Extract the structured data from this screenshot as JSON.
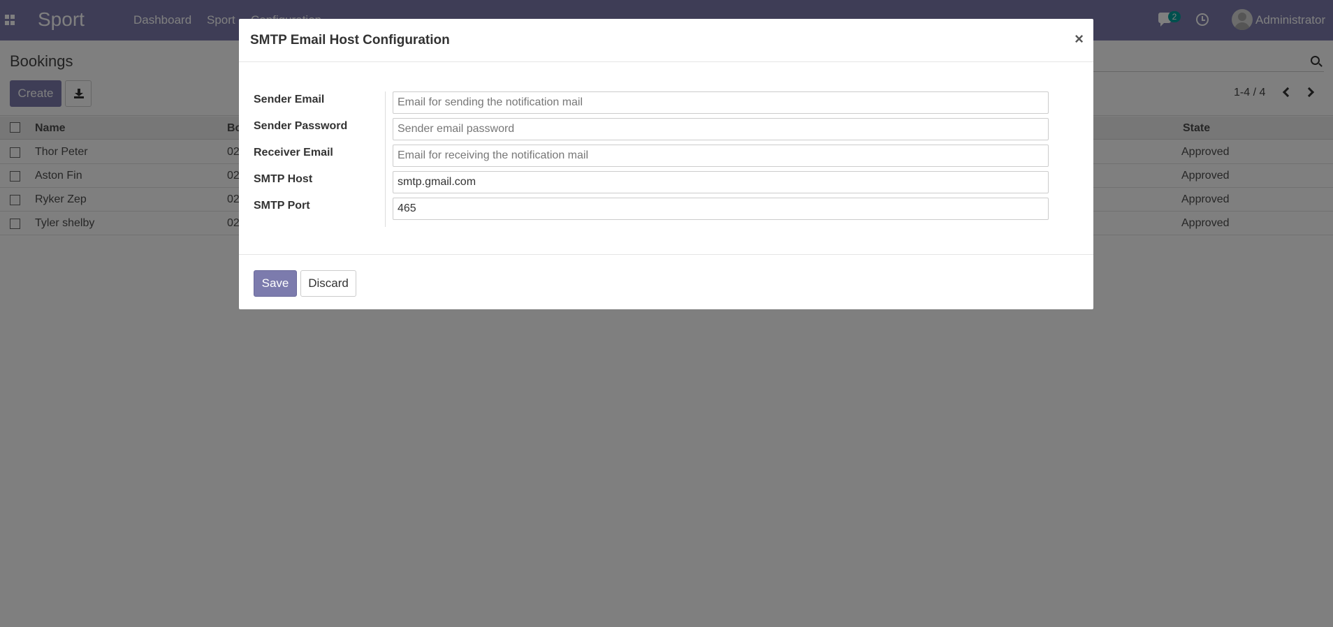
{
  "navbar": {
    "brand": "Sport",
    "menu": [
      "Dashboard",
      "Sport",
      "Configuration"
    ],
    "chat_count": "2",
    "user_name": "Administrator",
    "color": "#7c7bad"
  },
  "control_panel": {
    "breadcrumb": "Bookings",
    "create_label": "Create",
    "pager": "1-4 / 4"
  },
  "list": {
    "columns": [
      "Name",
      "Bo",
      "State"
    ],
    "rows": [
      {
        "name": "Thor Peter",
        "date": "02",
        "state": "Approved"
      },
      {
        "name": "Aston Fin",
        "date": "02",
        "state": "Approved"
      },
      {
        "name": "Ryker Zep",
        "date": "02",
        "state": "Approved"
      },
      {
        "name": "Tyler shelby",
        "date": "02",
        "state": "Approved"
      }
    ]
  },
  "modal": {
    "title": "SMTP Email Host Configuration",
    "close_glyph": "×",
    "fields": [
      {
        "label": "Sender Email",
        "value": "",
        "placeholder": "Email for sending the notification mail"
      },
      {
        "label": "Sender Password",
        "value": "",
        "placeholder": "Sender email password"
      },
      {
        "label": "Receiver Email",
        "value": "",
        "placeholder": "Email for receiving the notification mail"
      },
      {
        "label": "SMTP Host",
        "value": "smtp.gmail.com",
        "placeholder": ""
      },
      {
        "label": "SMTP Port",
        "value": "465",
        "placeholder": ""
      }
    ],
    "save_label": "Save",
    "discard_label": "Discard"
  }
}
